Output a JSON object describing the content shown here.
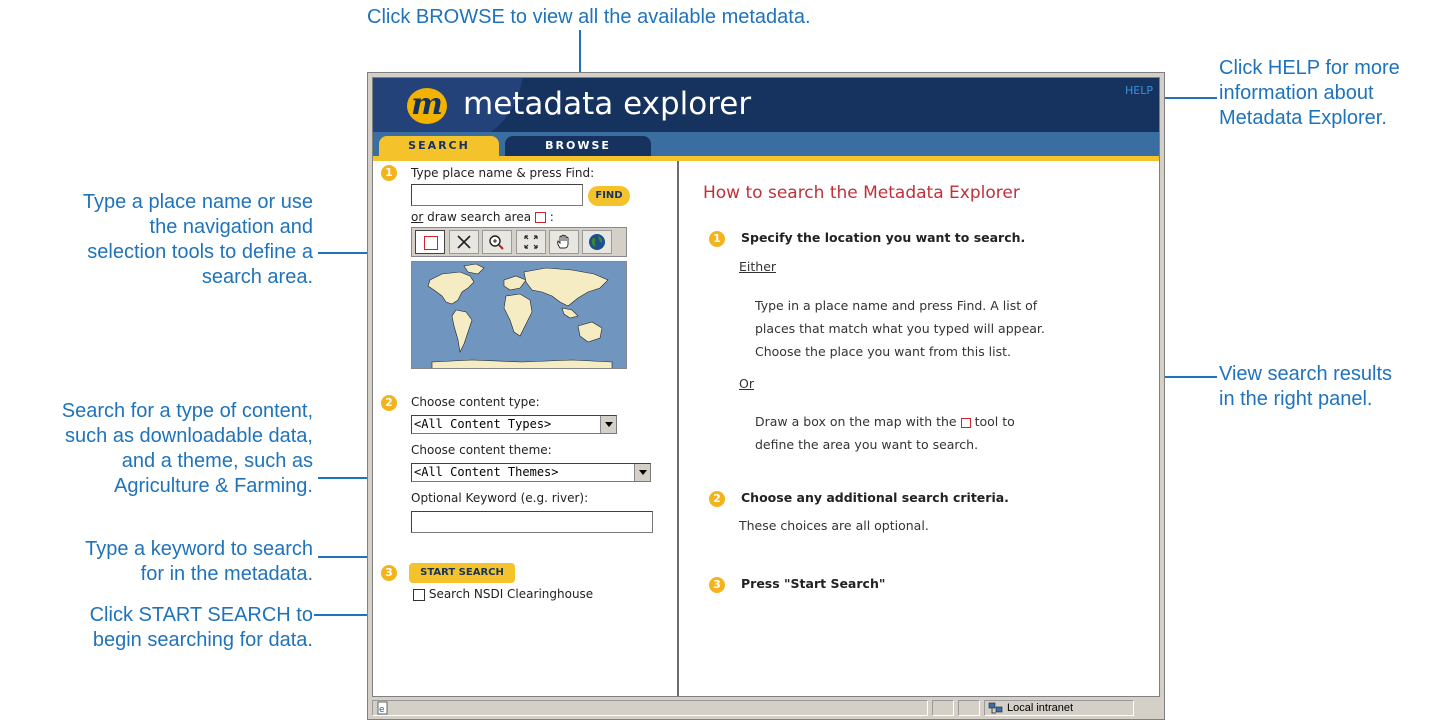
{
  "callouts": {
    "browse": "Click BROWSE to view all the available metadata.",
    "help": [
      "Click HELP for more",
      "information about",
      "Metadata Explorer."
    ],
    "place": [
      "Type a place name or use",
      "the navigation and",
      "selection tools to define a",
      "search area."
    ],
    "content": [
      "Search for a type of content,",
      "such as downloadable data,",
      "and a theme, such as",
      "Agriculture & Farming."
    ],
    "keyword": [
      "Type a keyword to search",
      "for in the metadata."
    ],
    "start": [
      "Click START SEARCH to",
      "begin searching for data."
    ],
    "results": [
      "View search results",
      "in the right panel."
    ]
  },
  "app": {
    "logo_letter": "m",
    "title": "metadata explorer",
    "help": "HELP",
    "tabs": {
      "search": "SEARCH",
      "browse": "BROWSE"
    }
  },
  "left": {
    "step1": "1",
    "place_label": "Type place name & press Find:",
    "find_button": "FIND",
    "or_text": "or",
    "draw_label": "draw search area",
    "draw_colon": ":",
    "step2": "2",
    "content_type_label": "Choose content type:",
    "content_type_value": "<All Content Types>",
    "content_theme_label": "Choose content theme:",
    "content_theme_value": "<All Content Themes>",
    "keyword_label": "Optional Keyword (e.g. river):",
    "step3": "3",
    "start_button": "START SEARCH",
    "nsdi_label": "Search NSDI Clearinghouse"
  },
  "right": {
    "heading": "How to search the Metadata Explorer",
    "step1": "1",
    "step1_title": "Specify the location you want to search.",
    "either": "Either",
    "either_lines": [
      "Type in a place name and press Find. A list of",
      "places that match what you typed will appear.",
      "Choose the place you want from this list."
    ],
    "or": "Or",
    "or_line1a": "Draw a box on the map with the",
    "or_line1b": "tool to",
    "or_line2": "define the area you want to search.",
    "step2": "2",
    "step2_title": "Choose any additional search criteria.",
    "step2_text": "These choices are all optional.",
    "step3": "3",
    "step3_title": "Press \"Start Search\""
  },
  "status": {
    "zone": "Local intranet"
  },
  "colors": {
    "callout": "#1f73bb",
    "header": "#16325f",
    "accent": "#f4c32c",
    "heading": "#c0303a"
  },
  "icons": [
    "rectangle-select-icon",
    "clear-icon",
    "zoom-in-icon",
    "full-extent-icon",
    "pan-hand-icon",
    "globe-icon",
    "ie-page-icon",
    "intranet-icon"
  ]
}
